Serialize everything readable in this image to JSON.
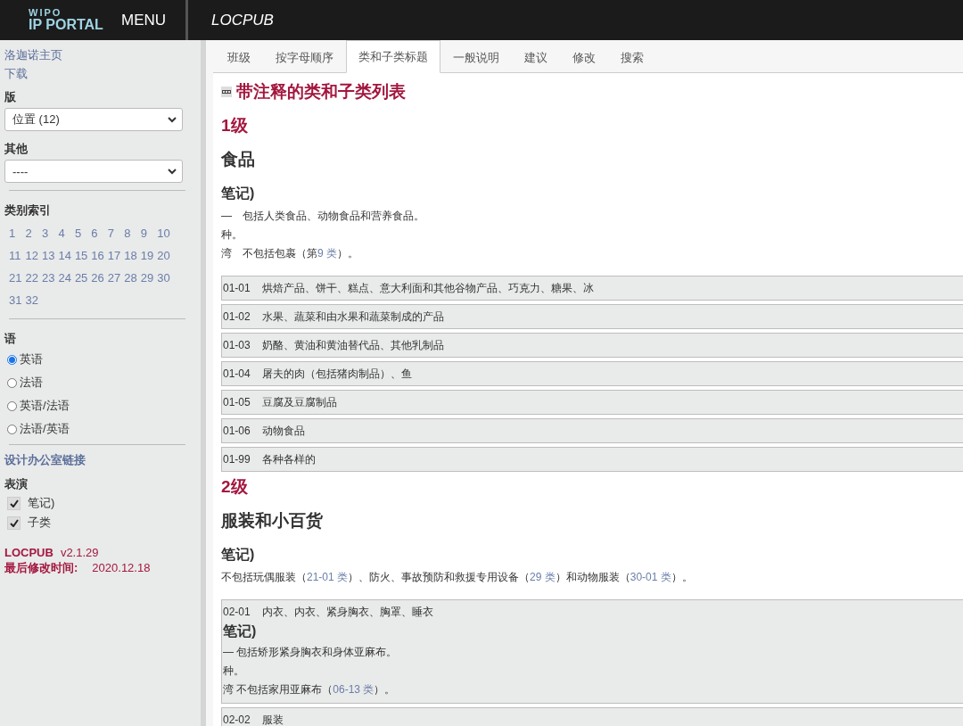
{
  "header": {
    "logo_top": "WIPO",
    "logo_bottom": "IP PORTAL",
    "menu": "MENU",
    "app_title": "LOCPUB"
  },
  "sidebar": {
    "links": [
      "洛迦诺主页",
      "下载"
    ],
    "edition": {
      "label": "版",
      "value": "位置 (12)"
    },
    "other": {
      "label": "其他",
      "value": "----"
    },
    "class_index": {
      "label": "类别索引",
      "numbers": [
        "1",
        "2",
        "3",
        "4",
        "5",
        "6",
        "7",
        "8",
        "9",
        "10",
        "11",
        "12",
        "13",
        "14",
        "15",
        "16",
        "17",
        "18",
        "19",
        "20",
        "21",
        "22",
        "23",
        "24",
        "25",
        "26",
        "27",
        "28",
        "29",
        "30",
        "31",
        "32"
      ]
    },
    "language": {
      "label": "语",
      "options": [
        {
          "label": "英语",
          "selected": true
        },
        {
          "label": "法语",
          "selected": false
        },
        {
          "label": "英语/法语",
          "selected": false
        },
        {
          "label": "法语/英语",
          "selected": false
        }
      ]
    },
    "office_link": "设计办公室链接",
    "display": {
      "label": "表演",
      "options": [
        {
          "label": "笔记)",
          "checked": true
        },
        {
          "label": "子类",
          "checked": true
        }
      ]
    },
    "version": {
      "name": "LOCPUB",
      "number": "v2.1.29"
    },
    "modified": {
      "label": "最后修改时间:",
      "date": "2020.12.18"
    }
  },
  "tabs": [
    {
      "label": "班级",
      "selected": false
    },
    {
      "label": "按字母顺序",
      "selected": false
    },
    {
      "label": "类和子类标题",
      "selected": true
    },
    {
      "label": "一般说明",
      "selected": false
    },
    {
      "label": "建议",
      "selected": false
    },
    {
      "label": "修改",
      "selected": false
    },
    {
      "label": "搜索",
      "selected": false
    }
  ],
  "page_title": "带注释的类和子类列表",
  "classes": [
    {
      "number": "1级",
      "title": "食品",
      "notes_label": "笔记)",
      "notes": [
        [
          {
            "kind": "text",
            "text": "—　包括人类食品、动物食品和营养食品。"
          }
        ],
        [
          {
            "kind": "text",
            "text": "种。"
          }
        ],
        [
          {
            "kind": "text",
            "text": "湾　不包括包裹（第"
          },
          {
            "kind": "link",
            "text": "9 类"
          },
          {
            "kind": "text",
            "text": "）。"
          }
        ]
      ],
      "subclasses": [
        {
          "kind": "plain",
          "code": "01-01",
          "title": "烘焙产品、饼干、糕点、意大利面和其他谷物产品、巧克力、糖果、冰"
        },
        {
          "kind": "plain",
          "code": "01-02",
          "title": "水果、蔬菜和由水果和蔬菜制成的产品"
        },
        {
          "kind": "plain",
          "code": "01-03",
          "title": "奶酪、黄油和黄油替代品、其他乳制品"
        },
        {
          "kind": "plain",
          "code": "01-04",
          "title": "屠夫的肉（包括猪肉制品）、鱼"
        },
        {
          "kind": "plain",
          "code": "01-05",
          "title": "豆腐及豆腐制品"
        },
        {
          "kind": "plain",
          "code": "01-06",
          "title": "动物食品"
        },
        {
          "kind": "plain",
          "code": "01-99",
          "title": "各种各样的"
        }
      ]
    },
    {
      "number": "2级",
      "title": "服装和小百货",
      "notes_label": "笔记)",
      "notes": [
        [
          {
            "kind": "text",
            "text": "不包括玩偶服装（"
          },
          {
            "kind": "link",
            "text": "21-01 类"
          },
          {
            "kind": "text",
            "text": "）、防火、事故预防和救援专用设备（"
          },
          {
            "kind": "link",
            "text": "29 类"
          },
          {
            "kind": "text",
            "text": "）和动物服装（"
          },
          {
            "kind": "link",
            "text": "30-01 类"
          },
          {
            "kind": "text",
            "text": "）。"
          }
        ]
      ],
      "subclasses": [
        {
          "kind": "with_notes",
          "code": "02-01",
          "title": "内衣、内衣、紧身胸衣、胸罩、睡衣",
          "notes_label": "笔记)",
          "notes": [
            [
              {
                "kind": "text",
                "text": "— 包括矫形紧身胸衣和身体亚麻布。"
              }
            ],
            [
              {
                "kind": "text",
                "text": "种。"
              }
            ],
            [
              {
                "kind": "text",
                "text": "湾 不包括家用亚麻布（"
              },
              {
                "kind": "link",
                "text": "06-13 类"
              },
              {
                "kind": "text",
                "text": "）。"
              }
            ]
          ]
        },
        {
          "kind": "plain",
          "code": "02-02",
          "title": "服装"
        }
      ]
    }
  ]
}
